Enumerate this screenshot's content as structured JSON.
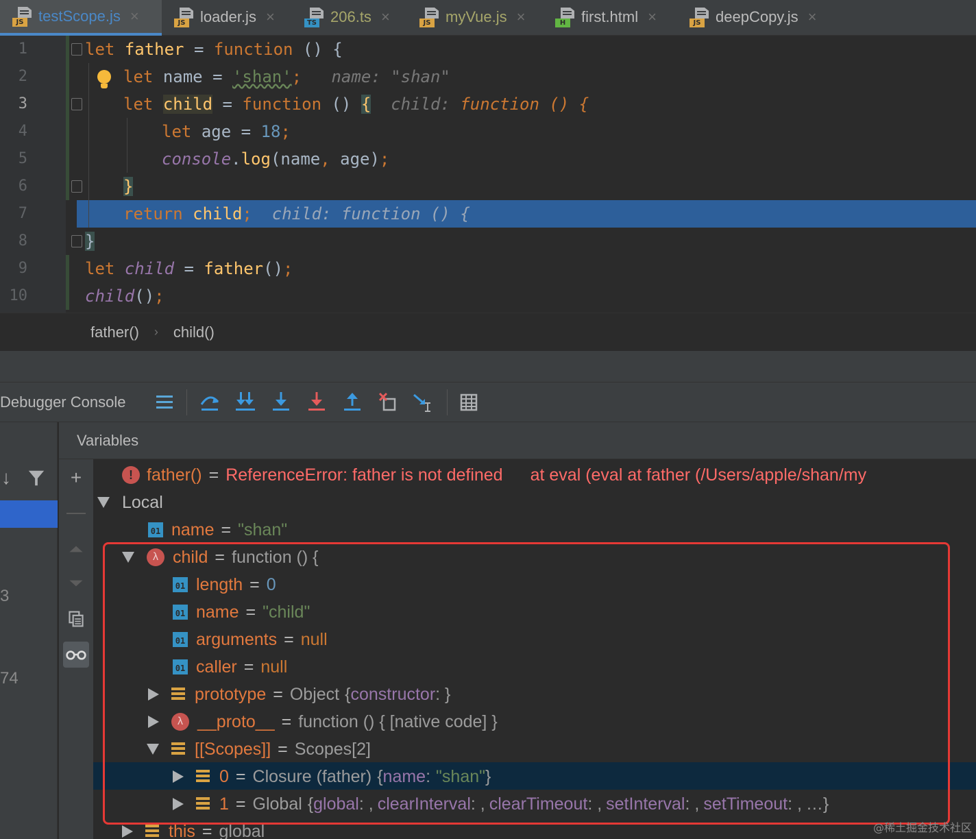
{
  "tabs": [
    {
      "name": "testScope.js",
      "badge": "JS",
      "badge_color": "#d9a343",
      "name_color": "#4a88c7",
      "active": true
    },
    {
      "name": "loader.js",
      "badge": "JS",
      "badge_color": "#d9a343",
      "name_color": "#bbbbbb",
      "active": false
    },
    {
      "name": "206.ts",
      "badge": "TS",
      "badge_color": "#3592c4",
      "name_color": "#a6a66a",
      "active": false
    },
    {
      "name": "myVue.js",
      "badge": "JS",
      "badge_color": "#d9a343",
      "name_color": "#a6a66a",
      "active": false
    },
    {
      "name": "first.html",
      "badge": "H",
      "badge_color": "#62b543",
      "name_color": "#bbbbbb",
      "active": false
    },
    {
      "name": "deepCopy.js",
      "badge": "JS",
      "badge_color": "#d9a343",
      "name_color": "#bbbbbb",
      "active": false
    }
  ],
  "tab_close": "×",
  "editor": {
    "line_numbers": [
      "1",
      "2",
      "3",
      "4",
      "5",
      "6",
      "7",
      "8",
      "9",
      "10"
    ],
    "current_line": "3",
    "lines": {
      "l1": {
        "kw": "let",
        "name": "father",
        "eq": "=",
        "kw2": "function",
        "rest": "() {"
      },
      "l2": {
        "kw": "let",
        "name": "name",
        "eq": "=",
        "str": "'shan'",
        "semi": ";",
        "hint_name": "name:",
        "hint_val": "\"shan\""
      },
      "l3": {
        "kw": "let",
        "name": "child",
        "eq": "=",
        "kw2": "function",
        "parens": "()",
        "brace": "{",
        "hint_name": "child:",
        "hint_kw": "function",
        "hint_rest": "() {"
      },
      "l4": {
        "kw": "let",
        "name": "age",
        "eq": "=",
        "num": "18",
        "semi": ";"
      },
      "l5": {
        "obj": "console",
        "dot": ".",
        "method": "log",
        "args": "(name",
        "comma": ",",
        "args2": "age)",
        "semi": ";"
      },
      "l6": {
        "brace": "}"
      },
      "l7": {
        "kw": "return",
        "name": "child",
        "semi": ";",
        "hint_name": "child:",
        "hint_kw": "function",
        "hint_rest": "() {"
      },
      "l8": {
        "brace": "}"
      },
      "l9": {
        "kw": "let",
        "name": "child",
        "eq": "=",
        "call": "father",
        "rest": "()",
        "semi": ";"
      },
      "l10": {
        "name": "child",
        "rest": "()",
        "semi": ";"
      }
    }
  },
  "breadcrumb": {
    "items": [
      "father()",
      "child()"
    ],
    "separator": "›"
  },
  "debugger": {
    "title": "Debugger Console",
    "toolbar": [
      "menu-icon",
      "step-over-icon",
      "step-into-icon",
      "force-step-into-icon",
      "force-step-into-red-icon",
      "step-out-icon",
      "drop-frame-icon",
      "run-to-cursor-icon",
      "evaluate-table-icon"
    ],
    "variables_title": "Variables",
    "frame_numbers": [
      "3",
      "74"
    ]
  },
  "variables": {
    "error": {
      "name": "father()",
      "eq": "=",
      "message": "ReferenceError: father is not defined",
      "location": "at eval (eval at father (/Users/apple/shan/my"
    },
    "local": {
      "label": "Local"
    },
    "name_var": {
      "name": "name",
      "eq": "=",
      "value": "\"shan\""
    },
    "child": {
      "name": "child",
      "eq": "=",
      "value": "function () {"
    },
    "length": {
      "name": "length",
      "eq": "=",
      "value": "0"
    },
    "fname": {
      "name": "name",
      "eq": "=",
      "value": "\"child\""
    },
    "arguments": {
      "name": "arguments",
      "eq": "=",
      "value": "null"
    },
    "caller": {
      "name": "caller",
      "eq": "=",
      "value": "null"
    },
    "prototype": {
      "name": "prototype",
      "eq": "=",
      "type": "Object",
      "open": "{",
      "prop": "constructor",
      "close": ": }"
    },
    "proto": {
      "name": "__proto__",
      "eq": "=",
      "value": "function () { [native code] }"
    },
    "scopes": {
      "name": "[[Scopes]]",
      "eq": "=",
      "value": "Scopes[2]"
    },
    "scope0": {
      "name": "0",
      "eq": "=",
      "type": "Closure (father)",
      "open": "{",
      "prop": "name",
      "colon": ":",
      "val": "\"shan\"",
      "close": "}"
    },
    "scope1": {
      "name": "1",
      "eq": "=",
      "type": "Global",
      "open": "{",
      "props": [
        "global",
        "clearInterval",
        "clearTimeout",
        "setInterval",
        "setTimeout"
      ],
      "sep": ": ,",
      "tail": "…}"
    },
    "this_var": {
      "name": "this",
      "eq": "=",
      "value": "global"
    }
  },
  "watermark": "@稀土掘金技术社区",
  "colors": {
    "highlight": "#2d5f9a",
    "selection": "#0d293e",
    "annotation_box": "#e53935"
  }
}
